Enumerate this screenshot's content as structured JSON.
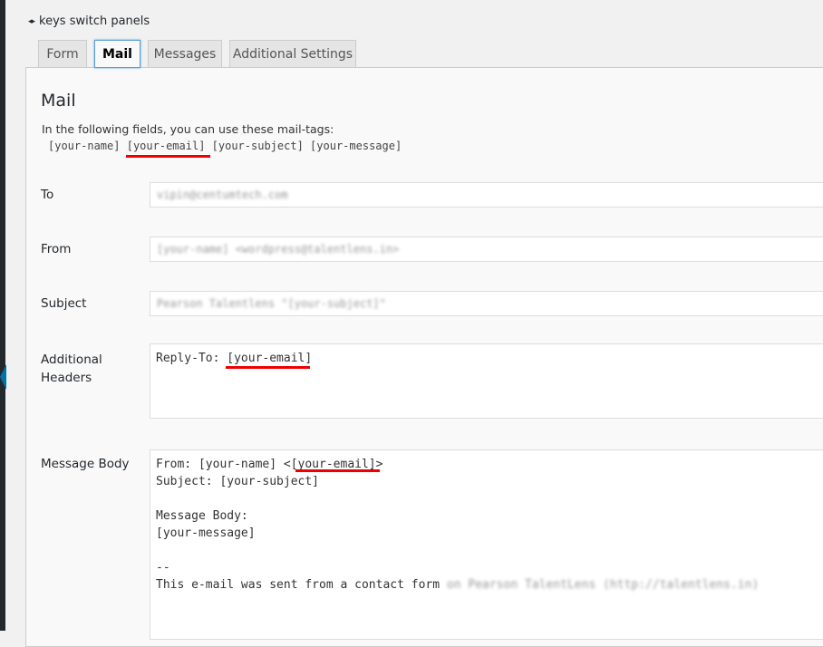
{
  "hint": {
    "arrows": "◂▸",
    "text": "keys switch panels"
  },
  "tabs": [
    {
      "label": "Form"
    },
    {
      "label": "Mail"
    },
    {
      "label": "Messages"
    },
    {
      "label": "Additional Settings"
    }
  ],
  "mail": {
    "title": "Mail",
    "description": "In the following fields, you can use these mail-tags:",
    "tags": [
      "[your-name]",
      "[your-email]",
      "[your-subject]",
      "[your-message]"
    ],
    "to": {
      "label": "To",
      "value": "vipin@centumtech.com"
    },
    "from": {
      "label": "From",
      "value": "[your-name] <wordpress@talentlens.in>"
    },
    "subject": {
      "label": "Subject",
      "value": "Pearson Talentlens \"[your-subject]\""
    },
    "additional_headers": {
      "label_line1": "Additional",
      "label_line2": "Headers",
      "value": "Reply-To: [your-email]"
    },
    "message_body": {
      "label": "Message Body",
      "line1": "From: [your-name] <[your-email]>",
      "line2": "Subject: [your-subject]",
      "line3": "",
      "line4": "Message Body:",
      "line5": "[your-message]",
      "line6": "",
      "line7": "--",
      "line8_visible": "This e-mail was sent from a contact form",
      "line8_blurred": " on Pearson TalentLens (http://talentlens.in)"
    }
  },
  "colors": {
    "highlight": "#e00000",
    "active_tab_border": "#5b9dd9"
  }
}
